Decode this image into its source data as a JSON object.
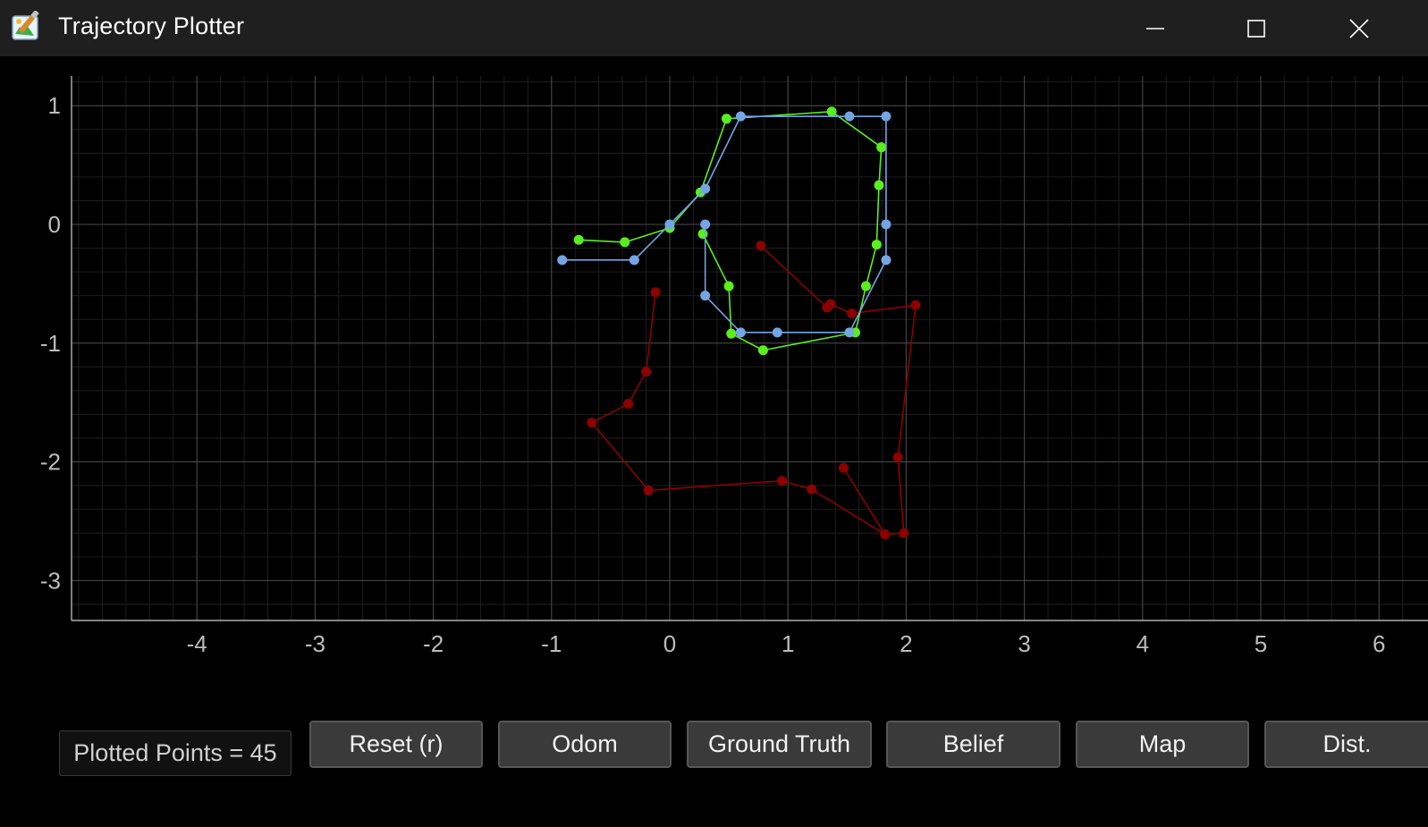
{
  "window": {
    "title": "Trajectory Plotter",
    "icon": "paintbrush-app-icon",
    "controls": [
      "minimize-icon",
      "maximize-icon",
      "close-icon"
    ]
  },
  "colors": {
    "background": "#000000",
    "titlebar": "#1f1f1f",
    "grid_major": "#4a4a4a",
    "grid_minor": "#1e1e1e",
    "odom": "#8b0000",
    "ground_truth": "#5aee1e",
    "belief": "#74a4e4"
  },
  "chart_data": {
    "type": "line",
    "title": "",
    "xlabel": "",
    "ylabel": "",
    "xlim": [
      -5.05,
      6.2
    ],
    "ylim": [
      -3.35,
      1.25
    ],
    "xticks": [
      -4,
      -3,
      -2,
      -1,
      0,
      1,
      2,
      3,
      4,
      5,
      6
    ],
    "yticks": [
      1,
      0,
      -1,
      -2,
      -3
    ],
    "xtick_labels": [
      "-4",
      "-3",
      "-2",
      "-1",
      "0",
      "1",
      "2",
      "3",
      "4",
      "5",
      "6"
    ],
    "ytick_labels": [
      "1",
      "0",
      "-1",
      "-2",
      "-3"
    ],
    "grid": true,
    "legend": "none",
    "series": [
      {
        "color": "#8b0000",
        "points": [
          [
            0.77,
            -0.18
          ],
          [
            1.33,
            -0.7
          ],
          [
            1.36,
            -0.67
          ],
          [
            1.54,
            -0.75
          ],
          [
            2.08,
            -0.68
          ],
          [
            1.93,
            -1.96
          ],
          [
            1.98,
            -2.6
          ],
          [
            1.82,
            -2.61
          ],
          [
            1.47,
            -2.05
          ],
          [
            1.82,
            -2.61
          ],
          [
            1.2,
            -2.23
          ],
          [
            0.95,
            -2.16
          ],
          [
            -0.18,
            -2.24
          ],
          [
            -0.66,
            -1.67
          ],
          [
            -0.35,
            -1.51
          ],
          [
            -0.2,
            -1.24
          ],
          [
            -0.12,
            -0.57
          ]
        ]
      },
      {
        "color": "#5aee1e",
        "points": [
          [
            -0.77,
            -0.13
          ],
          [
            -0.38,
            -0.15
          ],
          [
            0.0,
            -0.03
          ],
          [
            0.26,
            0.27
          ],
          [
            0.48,
            0.89
          ],
          [
            1.37,
            0.95
          ],
          [
            1.79,
            0.65
          ],
          [
            1.77,
            0.33
          ],
          [
            1.75,
            -0.17
          ],
          [
            1.66,
            -0.52
          ],
          [
            1.57,
            -0.91
          ],
          [
            0.79,
            -1.06
          ],
          [
            0.52,
            -0.92
          ],
          [
            0.5,
            -0.52
          ],
          [
            0.28,
            -0.08
          ]
        ]
      },
      {
        "color": "#74a4e4",
        "points": [
          [
            -0.91,
            -0.3
          ],
          [
            -0.3,
            -0.3
          ],
          [
            0.0,
            0.0
          ],
          [
            0.3,
            0.3
          ],
          [
            0.6,
            0.91
          ],
          [
            1.52,
            0.91
          ],
          [
            1.83,
            0.91
          ],
          [
            1.83,
            0.0
          ],
          [
            1.83,
            -0.3
          ],
          [
            1.52,
            -0.91
          ],
          [
            0.91,
            -0.91
          ],
          [
            0.6,
            -0.91
          ],
          [
            0.3,
            -0.6
          ],
          [
            0.3,
            0.0
          ]
        ]
      }
    ]
  },
  "status": {
    "plotted_points": "Plotted Points = 45"
  },
  "buttons": {
    "reset": "Reset (r)",
    "odom": "Odom",
    "ground_truth": "Ground Truth",
    "belief": "Belief",
    "map": "Map",
    "dist": "Dist."
  }
}
